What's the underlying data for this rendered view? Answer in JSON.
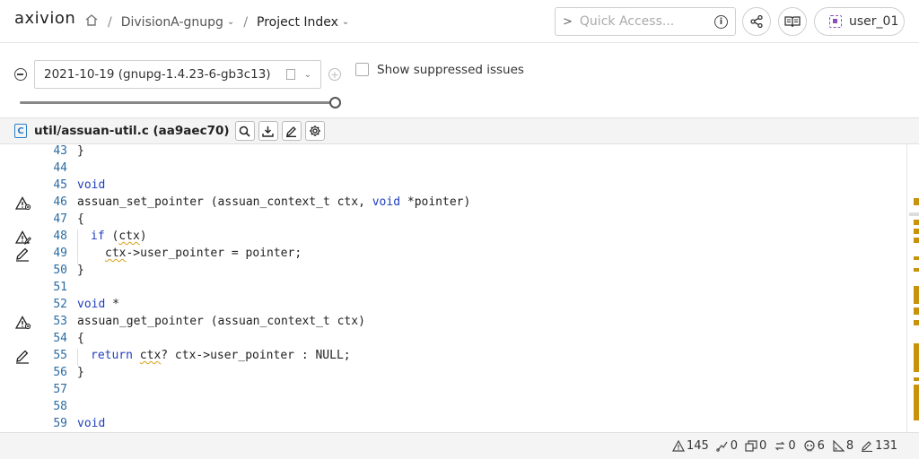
{
  "header": {
    "logo": "axivion",
    "breadcrumb": {
      "project": "DivisionA-gnupg",
      "page": "Project Index"
    },
    "quick_access_placeholder": "Quick Access...",
    "user": "user_01"
  },
  "toolbar": {
    "version": "2021-10-19 (gnupg-1.4.23-6-gb3c13)",
    "show_suppressed_label": "Show suppressed issues",
    "slider_value_fraction": 1.0
  },
  "file": {
    "name": "util/assuan-util.c (aa9aec70)",
    "lang_badge": "C"
  },
  "code_lines": [
    {
      "n": "43",
      "icon": ""
    },
    {
      "n": "44",
      "icon": ""
    },
    {
      "n": "45",
      "icon": ""
    },
    {
      "n": "46",
      "icon": "warning-icon"
    },
    {
      "n": "47",
      "icon": ""
    },
    {
      "n": "48",
      "icon": "warning-edit-icon"
    },
    {
      "n": "49",
      "icon": "pencil-icon"
    },
    {
      "n": "50",
      "icon": ""
    },
    {
      "n": "51",
      "icon": ""
    },
    {
      "n": "52",
      "icon": ""
    },
    {
      "n": "53",
      "icon": "warning-icon"
    },
    {
      "n": "54",
      "icon": ""
    },
    {
      "n": "55",
      "icon": "pencil-icon"
    },
    {
      "n": "56",
      "icon": ""
    },
    {
      "n": "57",
      "icon": ""
    },
    {
      "n": "58",
      "icon": ""
    },
    {
      "n": "59",
      "icon": ""
    }
  ],
  "code_text": {
    "l43": "}",
    "l45": "void",
    "l46_fn": "assuan_set_pointer",
    "l46_open": " (assuan_context_t ctx, ",
    "l46_void": "void",
    "l46_rest": " *pointer)",
    "l47": "{",
    "l48_if": "if",
    "l48_open": " (",
    "l48_ctx": "ctx",
    "l48_close": ")",
    "l49_ctx": "ctx",
    "l49_rest": "->user_pointer = pointer;",
    "l50": "}",
    "l52_void": "void",
    "l52_star": " *",
    "l53": "assuan_get_pointer (assuan_context_t ctx)",
    "l54": "{",
    "l55_return": "return",
    "l55_sp": " ",
    "l55_ctx": "ctx",
    "l55_rest": "? ctx->user_pointer : NULL;",
    "l56": "}",
    "l59": "void"
  },
  "status": {
    "issues": "145",
    "clones": "0",
    "duplicates": "0",
    "cycles": "0",
    "deadcode": "6",
    "metrics": "8",
    "style": "131"
  },
  "colors": {
    "accent": "#c8920a",
    "keyword": "#1f3fbf",
    "line_number": "#2b6ca3"
  }
}
